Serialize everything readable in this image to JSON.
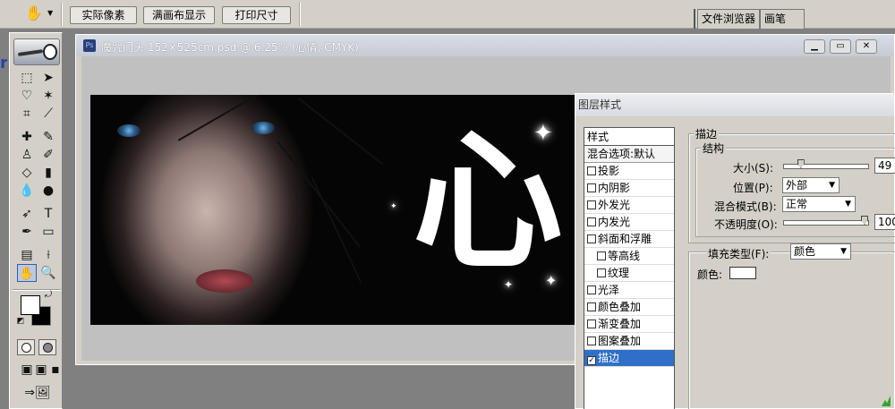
{
  "options_bar": {
    "hand_icon": "hand-tool-icon",
    "buttons": [
      "实际像素",
      "满画布显示",
      "打印尺寸"
    ]
  },
  "palette_well": {
    "tabs": [
      "文件浏览器",
      "画笔"
    ]
  },
  "toolbox": {
    "active_tool": "hand-tool",
    "foreground_color": "#ffffff",
    "background_color": "#000000"
  },
  "document": {
    "title": "魔咒门头   152×525cm.psd @ 6.25% (心情, CMYK)",
    "artwork_text": "心"
  },
  "layer_style": {
    "title": "图层样式",
    "styles_header": "样式",
    "items": [
      {
        "label": "混合选项:默认",
        "checkbox": false,
        "checked": false,
        "sub": false
      },
      {
        "label": "投影",
        "checkbox": true,
        "checked": false,
        "sub": false
      },
      {
        "label": "内阴影",
        "checkbox": true,
        "checked": false,
        "sub": false
      },
      {
        "label": "外发光",
        "checkbox": true,
        "checked": false,
        "sub": false
      },
      {
        "label": "内发光",
        "checkbox": true,
        "checked": false,
        "sub": false
      },
      {
        "label": "斜面和浮雕",
        "checkbox": true,
        "checked": false,
        "sub": false
      },
      {
        "label": "等高线",
        "checkbox": true,
        "checked": false,
        "sub": true
      },
      {
        "label": "纹理",
        "checkbox": true,
        "checked": false,
        "sub": true
      },
      {
        "label": "光泽",
        "checkbox": true,
        "checked": false,
        "sub": false
      },
      {
        "label": "颜色叠加",
        "checkbox": true,
        "checked": false,
        "sub": false
      },
      {
        "label": "渐变叠加",
        "checkbox": true,
        "checked": false,
        "sub": false
      },
      {
        "label": "图案叠加",
        "checkbox": true,
        "checked": false,
        "sub": false
      },
      {
        "label": "描边",
        "checkbox": true,
        "checked": true,
        "sub": false
      }
    ],
    "stroke": {
      "group_title": "描边",
      "structure_title": "结构",
      "size_label": "大小(S):",
      "size_value": "49",
      "size_fraction": 0.2,
      "position_label": "位置(P):",
      "position_value": "外部",
      "blend_label": "混合模式(B):",
      "blend_value": "正常",
      "opacity_label": "不透明度(O):",
      "opacity_value": "100",
      "opacity_fraction": 1.0,
      "fill_type_label": "填充类型(F):",
      "fill_type_value": "颜色",
      "color_label": "颜色:",
      "color_value": "#ffffff"
    }
  }
}
